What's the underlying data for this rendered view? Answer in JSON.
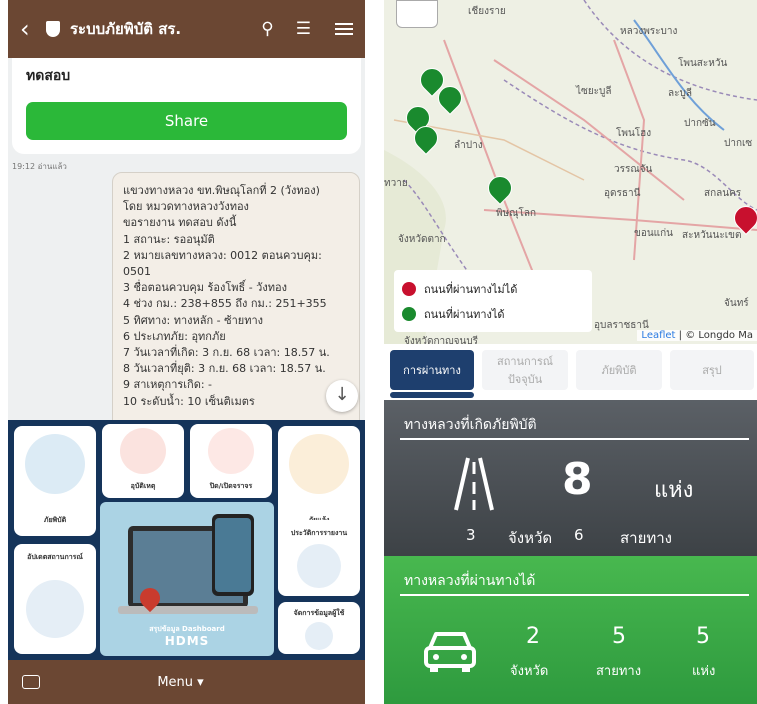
{
  "chat": {
    "header": {
      "title": "ระบบภัยพิบัติ สร."
    },
    "prev_message": "ทดสอบ",
    "share_label": "Share",
    "timestamp": "19:12 อ่านแล้ว",
    "message_lines": [
      "แขวงทางหลวง ขท.พิษณุโลกที่ 2 (วังทอง)",
      "โดย หมวดทางหลวงวังทอง",
      "",
      "ขอรายงาน ทดสอบ ดังนี้",
      "1 สถานะ: รออนุมัติ",
      "2 หมายเลขทางหลวง: 0012 ตอนควบคุม:",
      "0501",
      "3 ชื่อตอนควบคุม ร้องโพธิ์ - วังทอง",
      "4 ช่วง กม.: 238+855 ถึง กม.: 251+355",
      "5 ทิศทาง: ทางหลัก - ซ้ายทาง",
      "6 ประเภทภัย: อุทกภัย",
      "7 วันเวลาที่เกิด: 3 ก.ย. 68 เวลา: 18.57 น.",
      "8 วันเวลาที่ยุติ: 3 ก.ย. 68 เวลา: 18.57 น.",
      "9 สาเหตุการเกิด: -",
      "10 ระดับน้ำ: 10 เซ็นติเมตร"
    ],
    "rich_menu": {
      "tiles": [
        "ภัยพิบัติ",
        "อุบัติเหตุ",
        "ปิด/เปิดจราจร",
        "ภัยแล้ง",
        "อัปเดตสถานการณ์",
        "ประวัติการรายงาน",
        "จัดการข้อมูลผู้ใช้"
      ],
      "dashboard_label": "สรุปข้อมูล Dashboard",
      "dashboard_brand": "HDMS"
    },
    "footer_menu": "Menu ▾"
  },
  "map": {
    "labels": [
      "เชียงราย",
      "หลวงพระบาง",
      "โพนสะหวัน",
      "ไซยะบูลี",
      "ละบูลี",
      "ปากซัน",
      "ลำปาง",
      "โพนโฮง",
      "ปากเซ",
      "อุดรธานี",
      "สกลนคร",
      "พิษณุโลก",
      "จังหวัดตาก",
      "ขอนแก่น",
      "สะหวันนะเขต",
      "อุบลราชธานี",
      "จังหวัดกาญจนบุรี",
      "วรรณจัน",
      "จันทร์",
      "ทวาย"
    ],
    "legend": [
      {
        "label": "ถนนที่ผ่านทางไม่ได้",
        "color": "#c8102e"
      },
      {
        "label": "ถนนที่ผ่านทางได้",
        "color": "#1a8a2e"
      }
    ],
    "attribution_leaflet": "Leaflet",
    "attribution_rest": " | © Longdo Ma"
  },
  "tabs": [
    "การผ่านทาง",
    "สถานการณ์ปัจจุบัน",
    "ภัยพิบัติ",
    "สรุป"
  ],
  "disaster_section": {
    "title": "ทางหลวงที่เกิดภัยพิบัติ",
    "count": "8",
    "unit": "แห่ง",
    "provinces": "3",
    "provinces_label": "จังหวัด",
    "routes": "6",
    "routes_label": "สายทาง"
  },
  "passable_section": {
    "title": "ทางหลวงที่ผ่านทางได้",
    "provinces": "2",
    "provinces_label": "จังหวัด",
    "routes": "5",
    "routes_label": "สายทาง",
    "places": "5",
    "places_label": "แห่ง"
  }
}
